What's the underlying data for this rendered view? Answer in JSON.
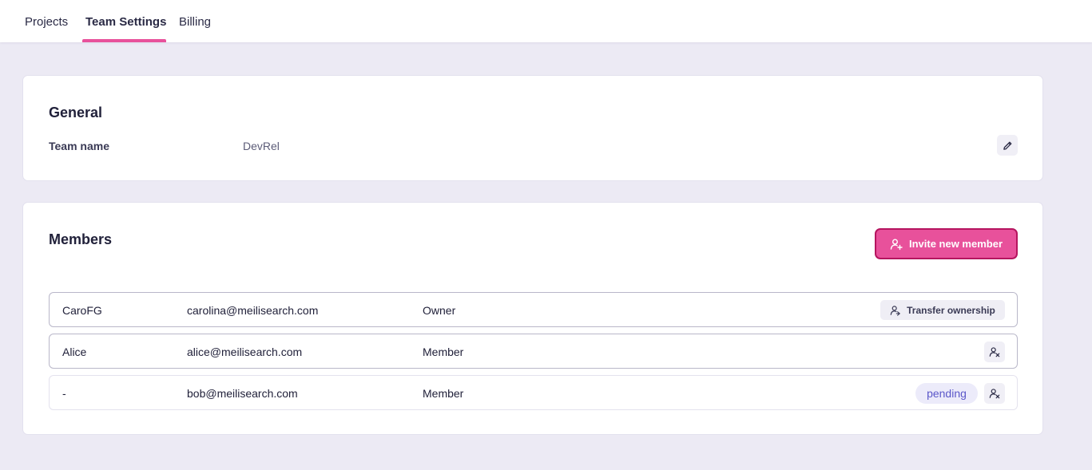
{
  "nav": {
    "tabs": [
      {
        "label": "Projects"
      },
      {
        "label": "Team Settings",
        "active": true
      },
      {
        "label": "Billing"
      }
    ]
  },
  "general": {
    "title": "General",
    "team_name_label": "Team name",
    "team_name_value": "DevRel",
    "edit_icon": "pencil-icon"
  },
  "members": {
    "title": "Members",
    "invite_label": "Invite new member",
    "invite_icon": "user-plus-icon",
    "rows": [
      {
        "name": "CaroFG",
        "email": "carolina@meilisearch.com",
        "role": "Owner",
        "action_label": "Transfer ownership",
        "action_icon": "user-transfer-icon"
      },
      {
        "name": "Alice",
        "email": "alice@meilisearch.com",
        "role": "Member",
        "action_icon": "user-remove-icon"
      },
      {
        "name": "-",
        "email": "bob@meilisearch.com",
        "role": "Member",
        "status": "pending",
        "action_icon": "user-remove-icon"
      }
    ]
  },
  "colors": {
    "accent": "#e8519b",
    "accent_border": "#b5155f",
    "background": "#eceaf4",
    "pending_text": "#5b57c9"
  }
}
